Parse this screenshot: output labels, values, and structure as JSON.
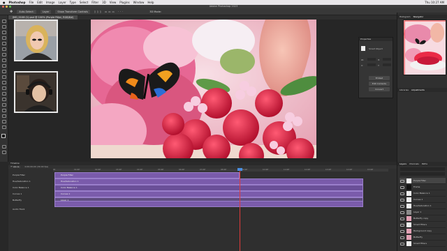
{
  "menubar": {
    "apple": "",
    "app": "Photoshop",
    "items": [
      "File",
      "Edit",
      "Image",
      "Layer",
      "Type",
      "Select",
      "Filter",
      "3D",
      "View",
      "Plugins",
      "Window",
      "Help"
    ],
    "clock": "Thu 10:27 AM"
  },
  "window": {
    "title": "Adobe Photoshop 2023"
  },
  "options_bar": {
    "items": [
      "Auto-Select:",
      "Layer",
      "Show Transform Controls"
    ],
    "mode_label": "3D Mode:"
  },
  "document_tab": {
    "label": "IMG_0108 (1).psd @ 100% (Purple Filter, RGB/8#)"
  },
  "properties": {
    "title": "Properties",
    "section": "Smart Object",
    "w_label": "W:",
    "h_label": "H:",
    "x_label": "X:",
    "y_label": "Y:",
    "btn_embed": "Embed",
    "btn_edit": "Edit Contents",
    "btn_convert": "Convert"
  },
  "right_panel": {
    "top_tabs": [
      "Histogram",
      "Navigator"
    ],
    "mid_tabs": [
      "Libraries",
      "Adjustments"
    ],
    "layers_tabs": [
      "Layers",
      "Channels",
      "Paths"
    ],
    "layers": [
      {
        "name": "Purple Filter"
      },
      {
        "name": "Frame"
      },
      {
        "name": "Color Balance 1"
      },
      {
        "name": "Curves 1"
      },
      {
        "name": "Hue/Saturation 1"
      },
      {
        "name": "Layer 1"
      },
      {
        "name": "Butterfly copy"
      },
      {
        "name": "Smart Filters"
      },
      {
        "name": "Background copy"
      },
      {
        "name": "Butterfly"
      },
      {
        "name": "Smart Filters"
      },
      {
        "name": "Background"
      }
    ]
  },
  "timeline": {
    "title": "Timeline",
    "controls": "0;00;00;00 (30.00 fps)",
    "ticks": [
      "00",
      "01:00f",
      "02:00f",
      "03:00f",
      "04:00f",
      "05:00f",
      "06:00f",
      "07:00f",
      "08:00f",
      "09:00f",
      "10:00f",
      "11:00f",
      "12:00f",
      "13:00f",
      "14:00f",
      "15:00f",
      "16:00f"
    ],
    "tracks": [
      {
        "name": "Purple Filter",
        "clip": "Purple Filter"
      },
      {
        "name": "Hue/Saturation 1",
        "clip": "Hue/Saturation 1"
      },
      {
        "name": "Color Balance 1",
        "clip": "Color Balance 1"
      },
      {
        "name": "Curves 1",
        "clip": "Curves 1"
      },
      {
        "name": "Butterfly",
        "clip": "Layer 1"
      },
      {
        "name": "Audio Track",
        "clip": ""
      }
    ]
  },
  "colors": {
    "clip_purple": "#7a5bab",
    "playhead": "#e03b3b",
    "panel_bg": "#303030"
  }
}
